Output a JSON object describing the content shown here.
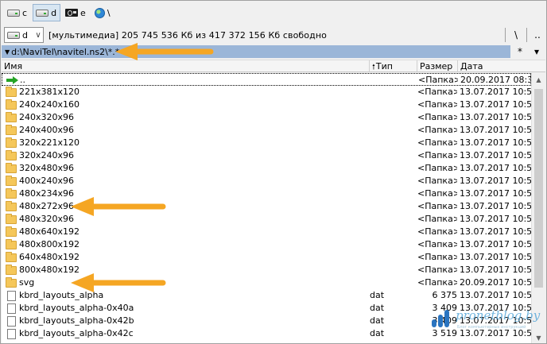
{
  "drives": [
    {
      "letter": "c",
      "active": false,
      "icon": "drive-icon"
    },
    {
      "letter": "d",
      "active": true,
      "icon": "drive-icon"
    },
    {
      "letter": "e",
      "active": false,
      "icon": "media-drive-icon"
    },
    {
      "letter": "\\",
      "active": false,
      "icon": "network-globe-icon"
    }
  ],
  "infobar": {
    "drive_letter": "d",
    "text": "[мультимедиа]  205 745 536 Кб из 417 372 156 Кб свободно",
    "root_button": "\\",
    "parent_button": ".."
  },
  "path": {
    "text": "d:\\NaviTel\\navitel.ns2\\*.*",
    "filter_button": "*",
    "history_button": "▾"
  },
  "columns": {
    "name": "Имя",
    "type": "Тип",
    "type_sort_arrow": "🠕",
    "size": "Размер",
    "date": "Дата"
  },
  "files": [
    {
      "name": "..",
      "ext": "",
      "size": "<Папка>",
      "date": "20.09.2017 08:33",
      "kind": "up"
    },
    {
      "name": "221x381x120",
      "ext": "",
      "size": "<Папка>",
      "date": "13.07.2017 10:52",
      "kind": "folder"
    },
    {
      "name": "240x240x160",
      "ext": "",
      "size": "<Папка>",
      "date": "13.07.2017 10:52",
      "kind": "folder"
    },
    {
      "name": "240x320x96",
      "ext": "",
      "size": "<Папка>",
      "date": "13.07.2017 10:52",
      "kind": "folder"
    },
    {
      "name": "240x400x96",
      "ext": "",
      "size": "<Папка>",
      "date": "13.07.2017 10:52",
      "kind": "folder"
    },
    {
      "name": "320x221x120",
      "ext": "",
      "size": "<Папка>",
      "date": "13.07.2017 10:52",
      "kind": "folder"
    },
    {
      "name": "320x240x96",
      "ext": "",
      "size": "<Папка>",
      "date": "13.07.2017 10:52",
      "kind": "folder"
    },
    {
      "name": "320x480x96",
      "ext": "",
      "size": "<Папка>",
      "date": "13.07.2017 10:52",
      "kind": "folder"
    },
    {
      "name": "400x240x96",
      "ext": "",
      "size": "<Папка>",
      "date": "13.07.2017 10:52",
      "kind": "folder"
    },
    {
      "name": "480x234x96",
      "ext": "",
      "size": "<Папка>",
      "date": "13.07.2017 10:52",
      "kind": "folder"
    },
    {
      "name": "480x272x96",
      "ext": "",
      "size": "<Папка>",
      "date": "13.07.2017 10:52",
      "kind": "folder"
    },
    {
      "name": "480x320x96",
      "ext": "",
      "size": "<Папка>",
      "date": "13.07.2017 10:52",
      "kind": "folder"
    },
    {
      "name": "480x640x192",
      "ext": "",
      "size": "<Папка>",
      "date": "13.07.2017 10:52",
      "kind": "folder"
    },
    {
      "name": "480x800x192",
      "ext": "",
      "size": "<Папка>",
      "date": "13.07.2017 10:52",
      "kind": "folder"
    },
    {
      "name": "640x480x192",
      "ext": "",
      "size": "<Папка>",
      "date": "13.07.2017 10:52",
      "kind": "folder"
    },
    {
      "name": "800x480x192",
      "ext": "",
      "size": "<Папка>",
      "date": "13.07.2017 10:52",
      "kind": "folder"
    },
    {
      "name": "svg",
      "ext": "",
      "size": "<Папка>",
      "date": "20.09.2017 10:50",
      "kind": "folder"
    },
    {
      "name": "kbrd_layouts_alpha",
      "ext": "dat",
      "size": "6 375",
      "date": "13.07.2017 10:52",
      "kind": "file"
    },
    {
      "name": "kbrd_layouts_alpha-0x40a",
      "ext": "dat",
      "size": "3 409",
      "date": "13.07.2017 10:52",
      "kind": "file"
    },
    {
      "name": "kbrd_layouts_alpha-0x42b",
      "ext": "dat",
      "size": "3 409",
      "date": "13.07.2017 10:52",
      "kind": "file"
    },
    {
      "name": "kbrd_layouts_alpha-0x42c",
      "ext": "dat",
      "size": "3 519",
      "date": "13.07.2017 10:52",
      "kind": "file"
    }
  ],
  "scrollbar": {
    "up": "▲",
    "down": "▼"
  },
  "watermark": {
    "name": "pronetblog.by",
    "tagline": "Блог компьютерных инструкций"
  },
  "colors": {
    "annotation_arrow": "#f5a623",
    "path_bar": "#9bb6d8",
    "folder": "#f5c75a"
  }
}
